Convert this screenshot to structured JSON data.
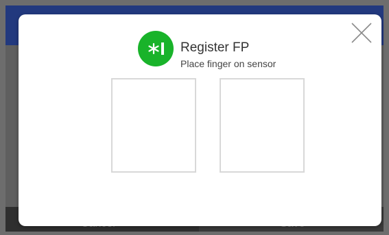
{
  "app": {
    "footer": {
      "cancel_label": "Cancel",
      "save_label": "Save"
    }
  },
  "dialog": {
    "title": "Register FP",
    "subtitle": "Place finger on sensor",
    "icon": "fingerprint-register-icon",
    "close_icon": "close-icon",
    "fingerprint_slots": 2
  },
  "colors": {
    "header_blue": "#22397e",
    "icon_green": "#19b32a",
    "overlay_gray": "#6d6d6d"
  }
}
